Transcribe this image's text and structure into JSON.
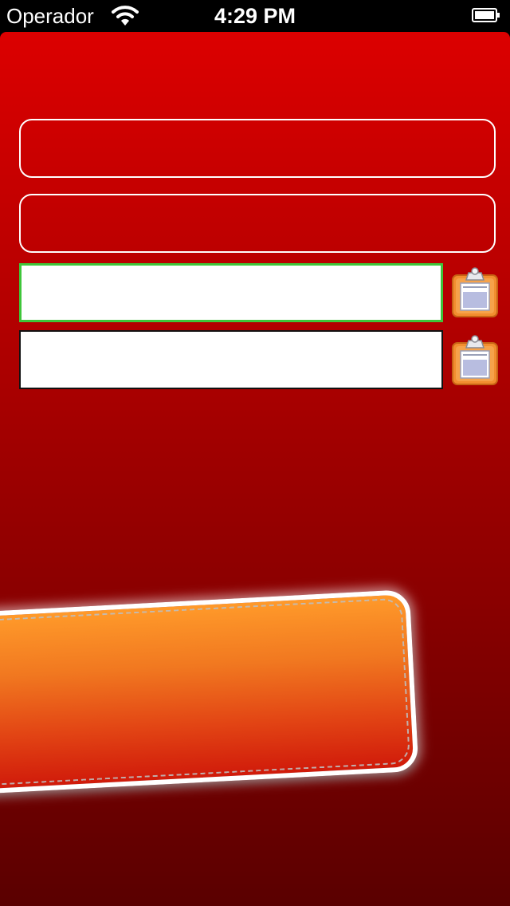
{
  "status_bar": {
    "carrier": "Operador",
    "time": "4:29 PM",
    "wifi_icon": "wifi-icon",
    "battery_icon": "battery-icon"
  },
  "form": {
    "field1": {
      "value": "",
      "placeholder": ""
    },
    "field2": {
      "value": "",
      "placeholder": ""
    },
    "field3": {
      "value": "",
      "placeholder": "",
      "clipboard_icon": "clipboard-icon"
    },
    "field4": {
      "value": "",
      "placeholder": "",
      "clipboard_icon": "clipboard-icon"
    }
  },
  "action_button": {
    "label": ""
  },
  "colors": {
    "background_top": "#dc0000",
    "background_bottom": "#5a0000",
    "focus_border": "#3ec63a",
    "button_top": "#ff9a2a",
    "button_bottom": "#d01a0a"
  }
}
